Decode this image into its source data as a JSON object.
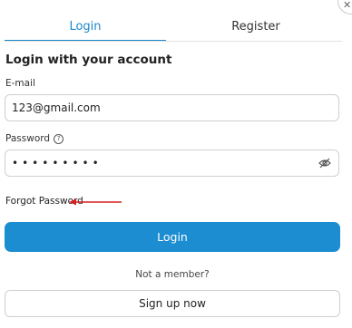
{
  "tabs": {
    "login": "Login",
    "register": "Register"
  },
  "heading": "Login with your account",
  "email": {
    "label": "E-mail",
    "value": "123@gmail.com"
  },
  "password": {
    "label": "Password",
    "value": "•••••••••"
  },
  "forgot_password": "Forgot Password",
  "login_button": "Login",
  "not_member": "Not a member?",
  "signup_button": "Sign up now",
  "colors": {
    "accent": "#1b8dd0",
    "annotation_arrow": "#d62020"
  },
  "icons": {
    "info": "info-icon",
    "visibility": "eye-off-icon",
    "close": "close-icon"
  }
}
